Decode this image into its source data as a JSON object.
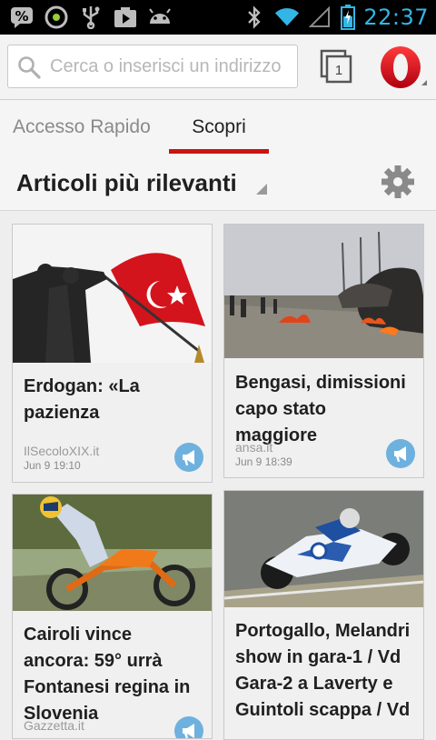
{
  "status_bar": {
    "time": "22:37",
    "left_icons": [
      "chat-percent-icon",
      "gauge-icon",
      "usb-icon",
      "play-store-icon",
      "android-icon"
    ],
    "right_icons": [
      "bluetooth-icon",
      "wifi-icon",
      "signal-icon",
      "battery-icon"
    ]
  },
  "urlbar": {
    "placeholder": "Cerca o inserisci un indirizzo",
    "tabs_count": "1"
  },
  "tabs": [
    {
      "label": "Accesso Rapido",
      "active": false
    },
    {
      "label": "Scopri",
      "active": true
    }
  ],
  "section": {
    "title": "Articoli più rilevanti"
  },
  "articles": [
    {
      "title": "Erdogan: «La pazienza",
      "source": "IlSecoloXIX.it",
      "time": "Jun 9 19:10"
    },
    {
      "title": "Bengasi, dimissioni capo stato maggiore",
      "source": "ansa.it",
      "time": "Jun 9 18:39"
    },
    {
      "title": "Cairoli vince ancora: 59° urrà Fontanesi regina in Slovenia",
      "source": "Gazzetta.it",
      "time": ""
    },
    {
      "title": "Portogallo, Melandri show in gara-1 / Vd Gara-2 a Laverty e Guintoli scappa / Vd",
      "source": "",
      "time": ""
    }
  ],
  "colors": {
    "accent_blue": "#33b5e5",
    "opera_red": "#cc0f16",
    "tab_underline": "#c81412",
    "share_blue": "#6eb1de"
  }
}
